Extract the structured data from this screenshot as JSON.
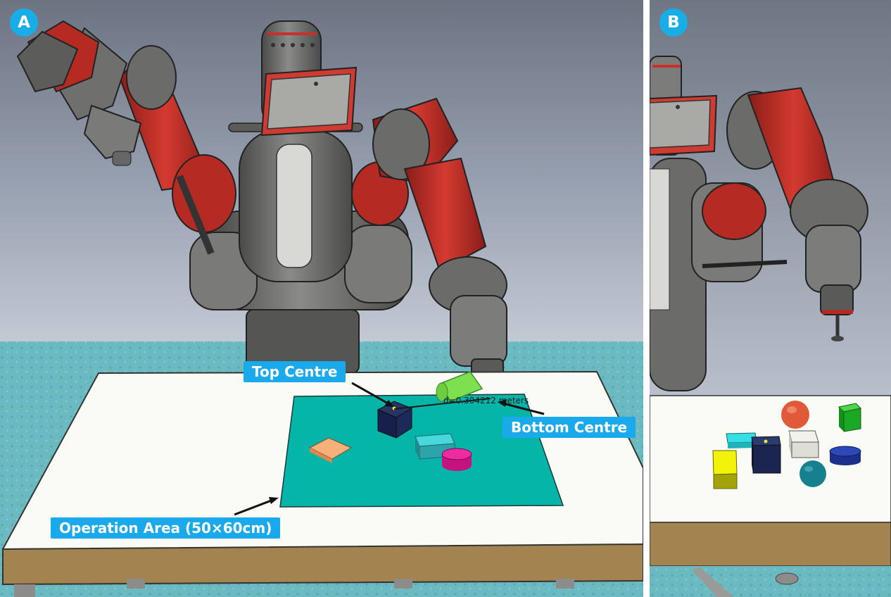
{
  "panels": {
    "a": {
      "badge": "A"
    },
    "b": {
      "badge": "B"
    }
  },
  "callouts": {
    "top_centre": "Top Centre",
    "bottom_centre": "Bottom Centre",
    "operation_area": "Operation Area (50×60cm)"
  },
  "measurement_readout": "d=0.304212 meters",
  "colors": {
    "badge": "#17aee8",
    "callout": "#1aa9ea",
    "robot_red": "#b52a22",
    "robot_gray": "#6b6b69",
    "operation_mat": "#05b5a8",
    "table_top": "#fbfbf6",
    "table_edge": "#a3834f",
    "floor": "#6fbcc2"
  }
}
